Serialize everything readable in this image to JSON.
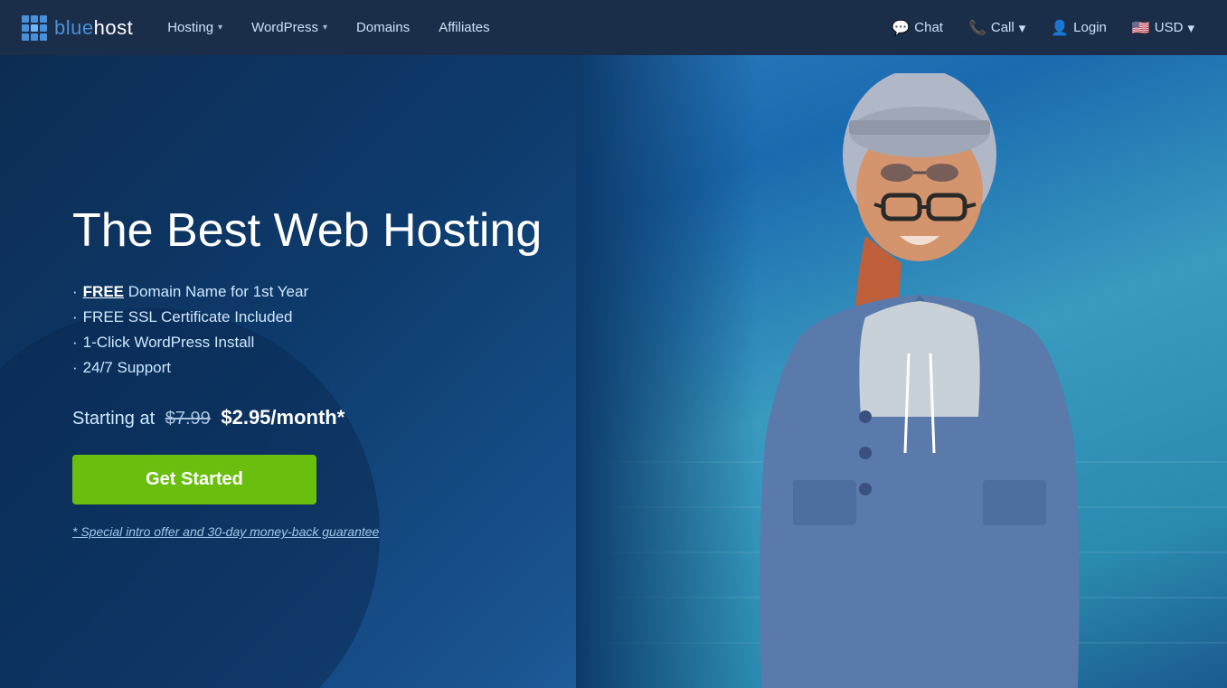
{
  "navbar": {
    "brand": {
      "name_prefix": "blue",
      "name_suffix": "host"
    },
    "nav_items": [
      {
        "label": "Hosting",
        "has_dropdown": true
      },
      {
        "label": "WordPress",
        "has_dropdown": true
      },
      {
        "label": "Domains",
        "has_dropdown": false
      },
      {
        "label": "Affiliates",
        "has_dropdown": false
      }
    ],
    "nav_right": [
      {
        "label": "Chat",
        "icon": "chat"
      },
      {
        "label": "Call",
        "icon": "phone",
        "has_dropdown": true
      },
      {
        "label": "Login",
        "icon": "user"
      },
      {
        "label": "USD",
        "icon": "flag",
        "has_dropdown": true
      }
    ]
  },
  "hero": {
    "title": "The Best Web Hosting",
    "features": [
      {
        "bullet": "·",
        "text": " Domain Name for 1st Year",
        "highlight": "FREE",
        "underline": true
      },
      {
        "bullet": "·",
        "text": "FREE SSL Certificate Included"
      },
      {
        "bullet": "·",
        "text": "1-Click WordPress Install"
      },
      {
        "bullet": "·",
        "text": "24/7 Support"
      }
    ],
    "pricing": {
      "prefix": "Starting at",
      "old_price": "$7.99",
      "new_price": "$2.95/month*"
    },
    "cta_button": "Get Started",
    "disclaimer": "* Special intro offer and 30-day money-back guarantee"
  }
}
